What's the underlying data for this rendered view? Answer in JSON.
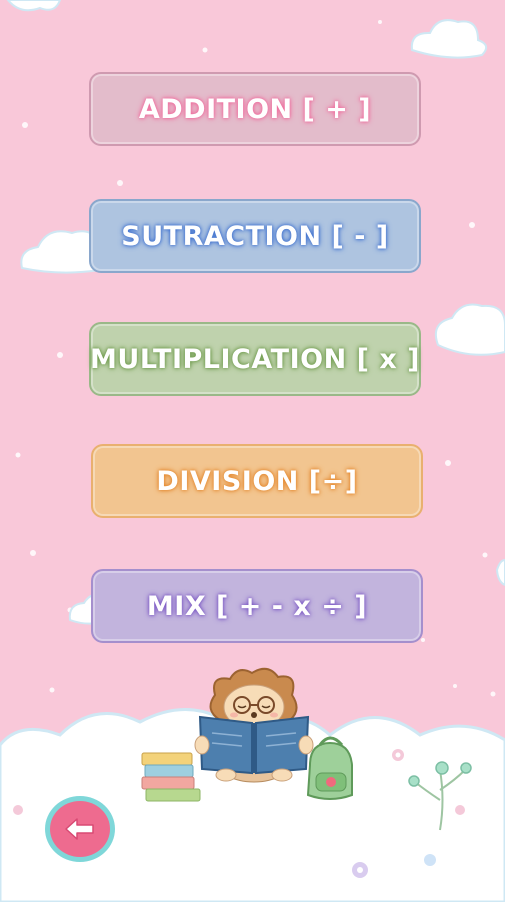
{
  "buttons": {
    "addition": "ADDITION  [ + ]",
    "subtraction": "SUTRACTION  [ - ]",
    "multiplication": "MULTIPLICATION [ x ]",
    "division": "DIVISION [÷]",
    "mix": "MIX  [ + - x ÷ ]"
  },
  "icons": {
    "back": "back-arrow-icon",
    "mascot": "hedgehog-reading-book",
    "books": "book-stack",
    "backpack": "green-backpack"
  },
  "colors": {
    "background": "#f9c8d9",
    "addition": "#e3bccb",
    "subtraction": "#aec4e0",
    "multiplication": "#bfd2ad",
    "division": "#f2c590",
    "mix": "#c2b4dd",
    "back_button": "#ee6b8f",
    "back_ring": "#7fd7d9"
  }
}
